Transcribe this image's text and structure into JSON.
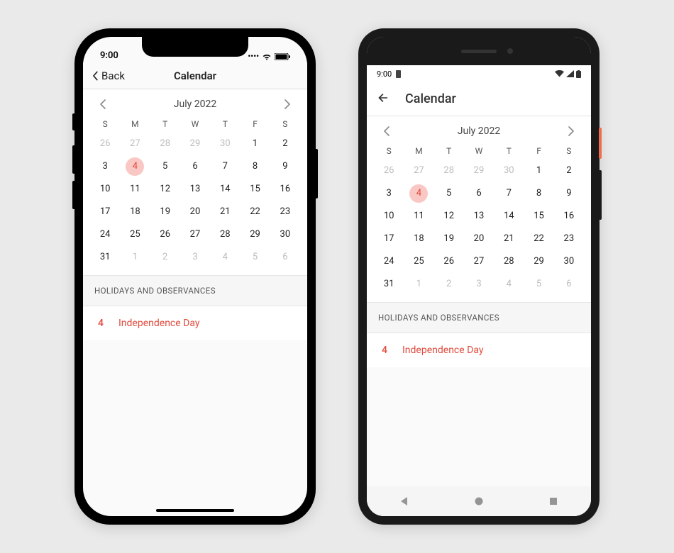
{
  "ios": {
    "status_time": "9:00",
    "back_label": "Back",
    "title": "Calendar"
  },
  "android": {
    "status_time": "9:00",
    "title": "Calendar"
  },
  "calendar": {
    "month_label": "July 2022",
    "weekdays": [
      "S",
      "M",
      "T",
      "W",
      "T",
      "F",
      "S"
    ],
    "weeks": [
      [
        {
          "n": "26",
          "out": true
        },
        {
          "n": "27",
          "out": true
        },
        {
          "n": "28",
          "out": true
        },
        {
          "n": "29",
          "out": true
        },
        {
          "n": "30",
          "out": true
        },
        {
          "n": "1"
        },
        {
          "n": "2"
        }
      ],
      [
        {
          "n": "3"
        },
        {
          "n": "4",
          "sel": true
        },
        {
          "n": "5"
        },
        {
          "n": "6"
        },
        {
          "n": "7"
        },
        {
          "n": "8"
        },
        {
          "n": "9"
        }
      ],
      [
        {
          "n": "10"
        },
        {
          "n": "11"
        },
        {
          "n": "12"
        },
        {
          "n": "13"
        },
        {
          "n": "14"
        },
        {
          "n": "15"
        },
        {
          "n": "16"
        }
      ],
      [
        {
          "n": "17"
        },
        {
          "n": "18"
        },
        {
          "n": "19"
        },
        {
          "n": "20"
        },
        {
          "n": "21"
        },
        {
          "n": "22"
        },
        {
          "n": "23"
        }
      ],
      [
        {
          "n": "24"
        },
        {
          "n": "25"
        },
        {
          "n": "26"
        },
        {
          "n": "27"
        },
        {
          "n": "28"
        },
        {
          "n": "29"
        },
        {
          "n": "30"
        }
      ],
      [
        {
          "n": "31"
        },
        {
          "n": "1",
          "out": true
        },
        {
          "n": "2",
          "out": true
        },
        {
          "n": "3",
          "out": true
        },
        {
          "n": "4",
          "out": true
        },
        {
          "n": "5",
          "out": true
        },
        {
          "n": "6",
          "out": true
        }
      ]
    ],
    "section_title": "HOLIDAYS AND OBSERVANCES",
    "events": [
      {
        "day": "4",
        "name": "Independence Day"
      }
    ]
  }
}
